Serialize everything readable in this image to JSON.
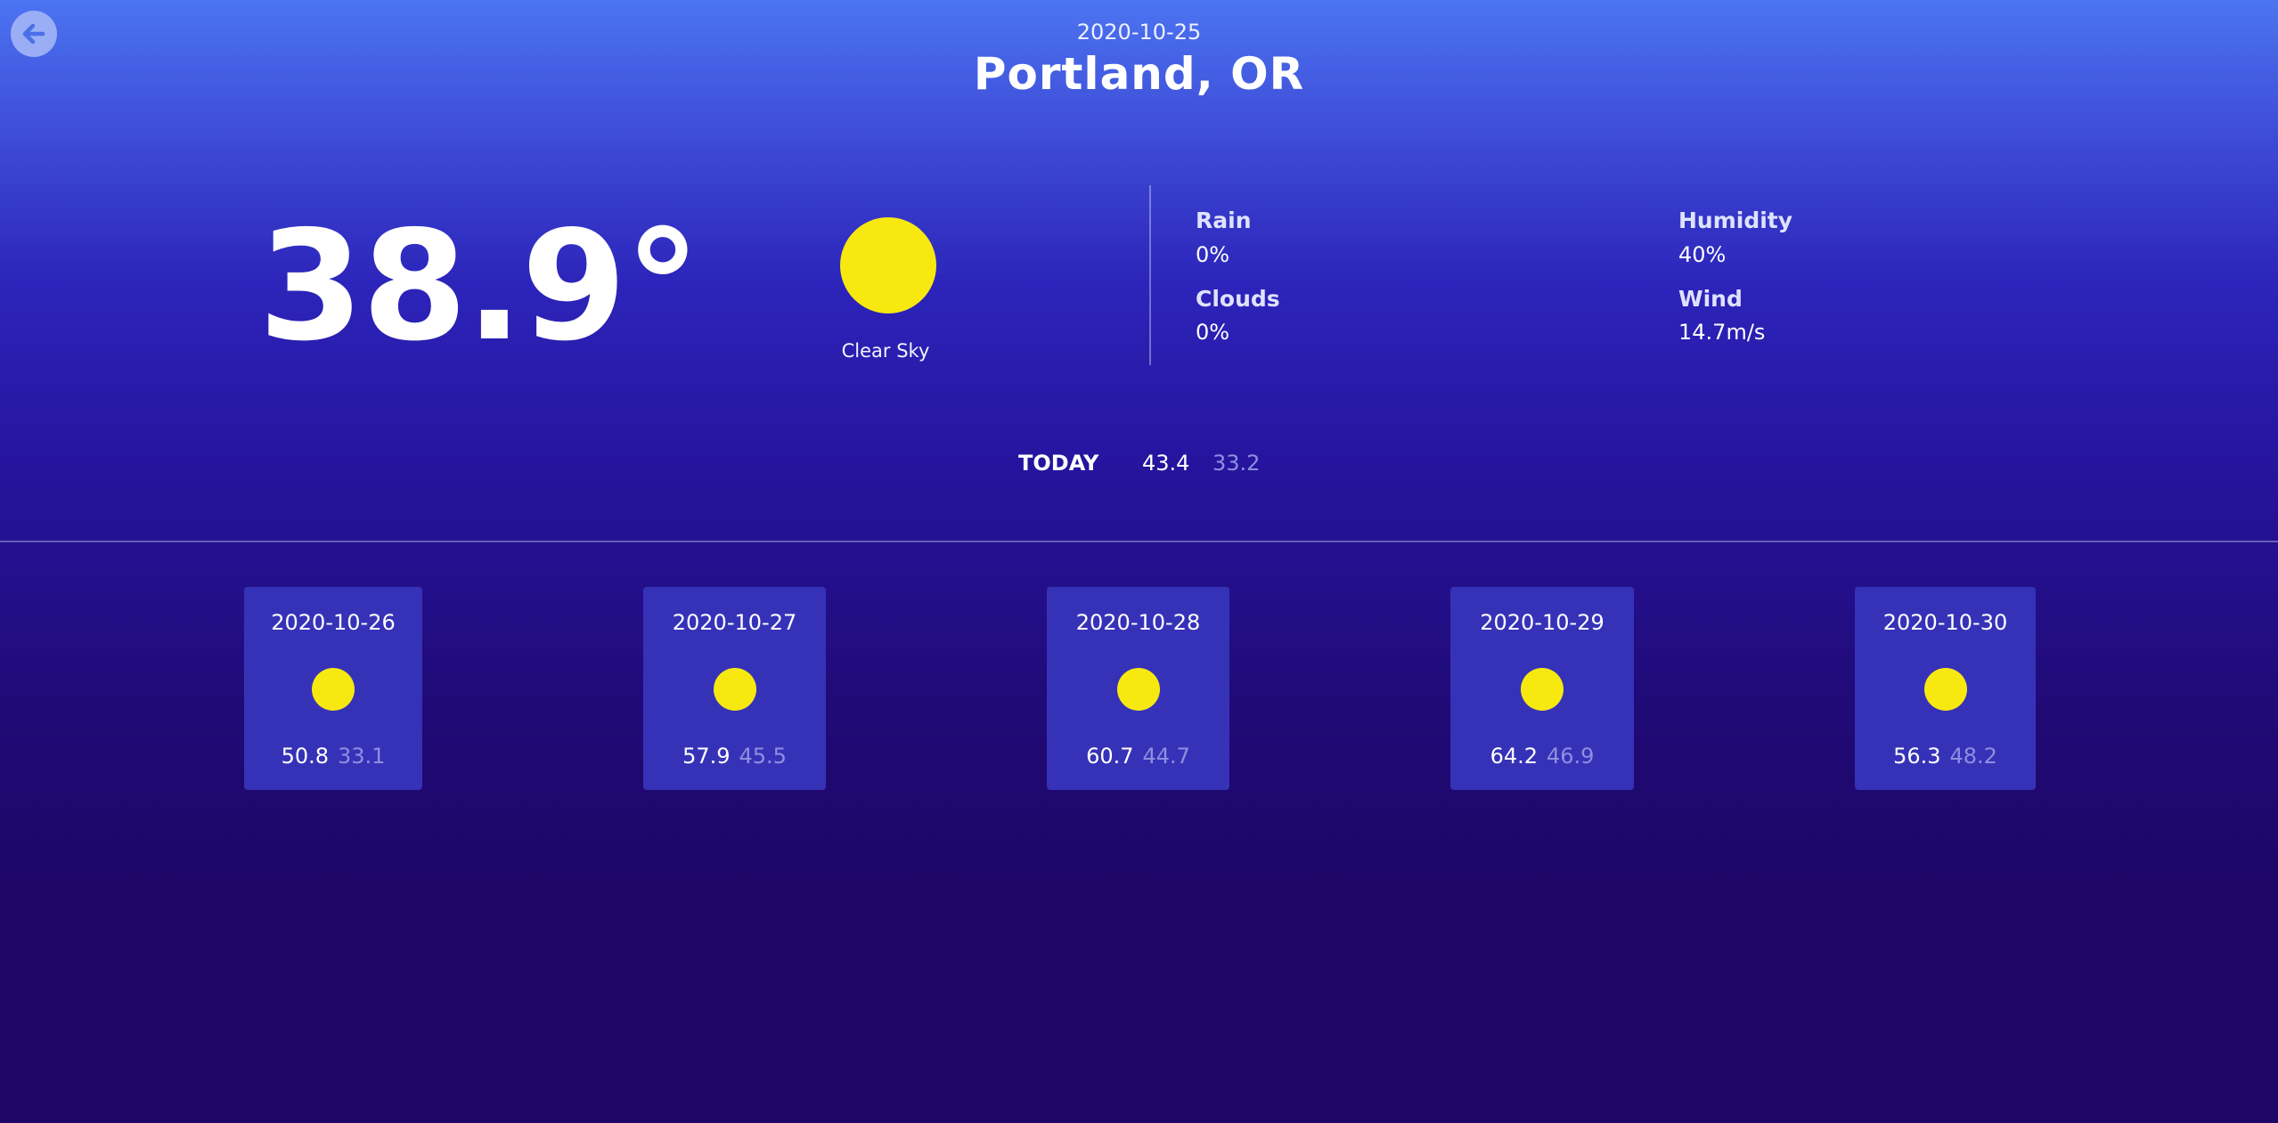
{
  "header": {
    "date": "2020-10-25",
    "city": "Portland, OR"
  },
  "current": {
    "temperature": "38.9°",
    "condition": "Clear Sky",
    "icon": "sun-icon"
  },
  "stats": {
    "rain_label": "Rain",
    "rain_value": "0%",
    "clouds_label": "Clouds",
    "clouds_value": "0%",
    "humidity_label": "Humidity",
    "humidity_value": "40%",
    "wind_label": "Wind",
    "wind_value": "14.7m/s"
  },
  "today": {
    "label": "TODAY",
    "high": "43.4",
    "low": "33.2"
  },
  "forecast": [
    {
      "date": "2020-10-26",
      "high": "50.8",
      "low": "33.1",
      "icon": "sun-icon"
    },
    {
      "date": "2020-10-27",
      "high": "57.9",
      "low": "45.5",
      "icon": "sun-icon"
    },
    {
      "date": "2020-10-28",
      "high": "60.7",
      "low": "44.7",
      "icon": "sun-icon"
    },
    {
      "date": "2020-10-29",
      "high": "64.2",
      "low": "46.9",
      "icon": "sun-icon"
    },
    {
      "date": "2020-10-30",
      "high": "56.3",
      "low": "48.2",
      "icon": "sun-icon"
    }
  ],
  "colors": {
    "sun": "#f7e910",
    "card_background": "#3632b8",
    "low_temp": "#8e8fe0",
    "back_button": "#9aaef5"
  }
}
